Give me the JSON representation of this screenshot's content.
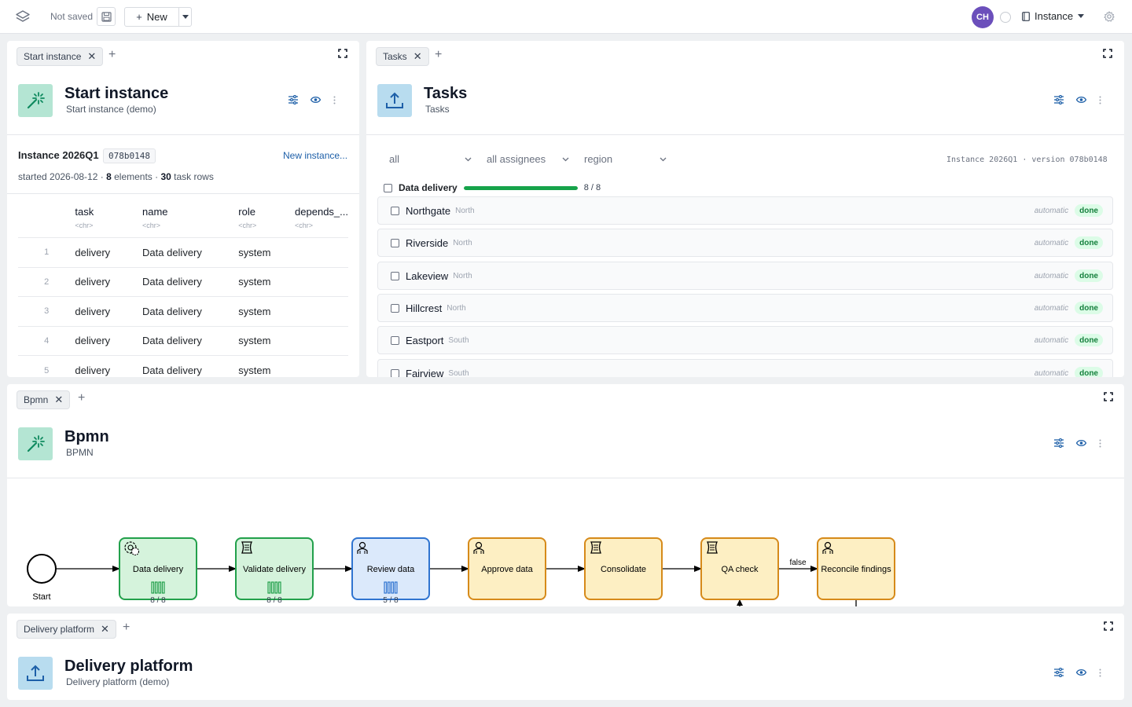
{
  "topbar": {
    "not_saved": "Not saved",
    "new_label": "New",
    "avatar_initials": "CH",
    "instance_label": "Instance"
  },
  "start_panel": {
    "tab_label": "Start instance",
    "title": "Start instance",
    "subtitle": "Start instance (demo)",
    "instance_title": "Instance 2026Q1",
    "hash": "078b0148",
    "new_instance_link": "New instance...",
    "meta_started": "started 2026-08-12 · ",
    "meta_elements_count": "8",
    "meta_elements_label": " elements · ",
    "meta_rows_count": "30",
    "meta_rows_label": " task rows",
    "table": {
      "columns": [
        {
          "name": "task",
          "type": "<chr>"
        },
        {
          "name": "name",
          "type": "<chr>"
        },
        {
          "name": "role",
          "type": "<chr>"
        },
        {
          "name": "depends_...",
          "type": "<chr>"
        }
      ],
      "rows": [
        {
          "idx": "1",
          "task": "delivery",
          "name": "Data delivery",
          "role": "system",
          "depends": ""
        },
        {
          "idx": "2",
          "task": "delivery",
          "name": "Data delivery",
          "role": "system",
          "depends": ""
        },
        {
          "idx": "3",
          "task": "delivery",
          "name": "Data delivery",
          "role": "system",
          "depends": ""
        },
        {
          "idx": "4",
          "task": "delivery",
          "name": "Data delivery",
          "role": "system",
          "depends": ""
        },
        {
          "idx": "5",
          "task": "delivery",
          "name": "Data delivery",
          "role": "system",
          "depends": ""
        }
      ]
    }
  },
  "tasks_panel": {
    "tab_label": "Tasks",
    "title": "Tasks",
    "subtitle": "Tasks",
    "filters": {
      "status": "all",
      "assignee": "all assignees",
      "region": "region"
    },
    "instance_version": "Instance 2026Q1 · version 078b0148",
    "group": {
      "label": "Data delivery",
      "done": 8,
      "total": 8,
      "count_label": "8 / 8"
    },
    "rows": [
      {
        "name": "Northgate",
        "region": "North",
        "mode": "automatic",
        "status": "done"
      },
      {
        "name": "Riverside",
        "region": "North",
        "mode": "automatic",
        "status": "done"
      },
      {
        "name": "Lakeview",
        "region": "North",
        "mode": "automatic",
        "status": "done"
      },
      {
        "name": "Hillcrest",
        "region": "North",
        "mode": "automatic",
        "status": "done"
      },
      {
        "name": "Eastport",
        "region": "South",
        "mode": "automatic",
        "status": "done"
      },
      {
        "name": "Fairview",
        "region": "South",
        "mode": "automatic",
        "status": "done"
      }
    ]
  },
  "bpmn_panel": {
    "tab_label": "Bpmn",
    "title": "Bpmn",
    "subtitle": "BPMN",
    "start_label": "Start",
    "flow_label_false": "false",
    "nodes": [
      {
        "label": "Data delivery",
        "kind": "service",
        "state": "done",
        "progress": "8 / 8"
      },
      {
        "label": "Validate delivery",
        "kind": "script",
        "state": "done",
        "progress": "8 / 8"
      },
      {
        "label": "Review data",
        "kind": "user",
        "state": "active",
        "progress": "5 / 8"
      },
      {
        "label": "Approve data",
        "kind": "user",
        "state": "pending",
        "progress": ""
      },
      {
        "label": "Consolidate",
        "kind": "script",
        "state": "pending",
        "progress": ""
      },
      {
        "label": "QA check",
        "kind": "script",
        "state": "pending",
        "progress": ""
      },
      {
        "label": "Reconcile findings",
        "kind": "user",
        "state": "pending",
        "progress": ""
      }
    ],
    "colors": {
      "done_fill": "#d5f3dc",
      "done_stroke": "#22a04b",
      "active_fill": "#dbe9fb",
      "active_stroke": "#2f74d0",
      "pending_fill": "#fdefc3",
      "pending_stroke": "#d68a1a"
    }
  },
  "platform_panel": {
    "tab_label": "Delivery platform",
    "title": "Delivery platform",
    "subtitle": "Delivery platform (demo)"
  },
  "icons": {
    "magic": "magic-wand-icon",
    "upload": "upload-icon",
    "settings": "sliders-icon",
    "view": "eye-icon",
    "more": "kebab-icon"
  }
}
